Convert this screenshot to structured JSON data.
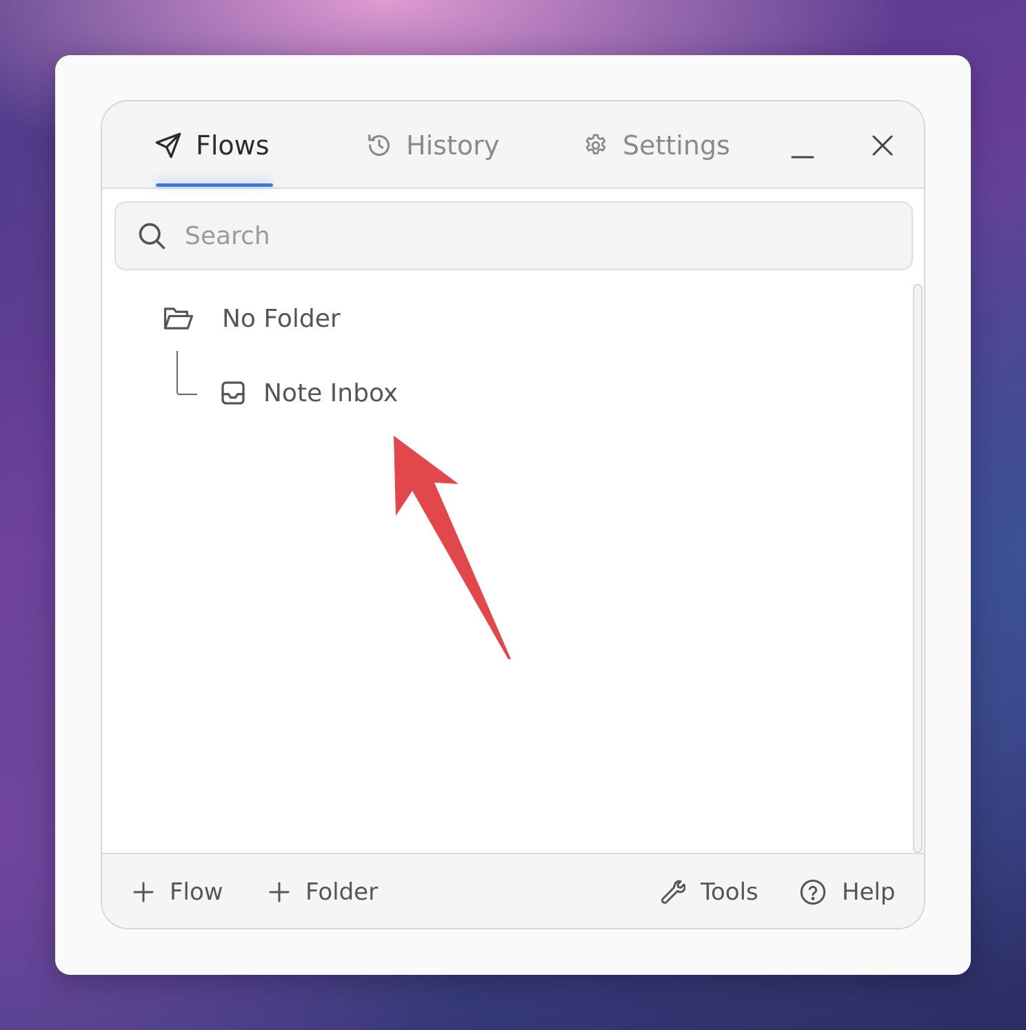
{
  "tabs": [
    {
      "label": "Flows",
      "icon": "send-icon",
      "active": true
    },
    {
      "label": "History",
      "icon": "history-icon",
      "active": false
    },
    {
      "label": "Settings",
      "icon": "gear-icon",
      "active": false
    }
  ],
  "window_controls": {
    "minimize_icon": "minimize-icon",
    "close_icon": "close-icon"
  },
  "search": {
    "placeholder": "Search",
    "value": ""
  },
  "tree": {
    "folder": {
      "label": "No Folder",
      "icon": "folder-open-icon"
    },
    "items": [
      {
        "label": "Note Inbox",
        "icon": "inbox-icon"
      }
    ]
  },
  "footer": {
    "add_flow": "Flow",
    "add_folder": "Folder",
    "tools": "Tools",
    "help": "Help"
  },
  "colors": {
    "accent": "#3b78d8",
    "annotation_arrow": "#e2474b"
  }
}
